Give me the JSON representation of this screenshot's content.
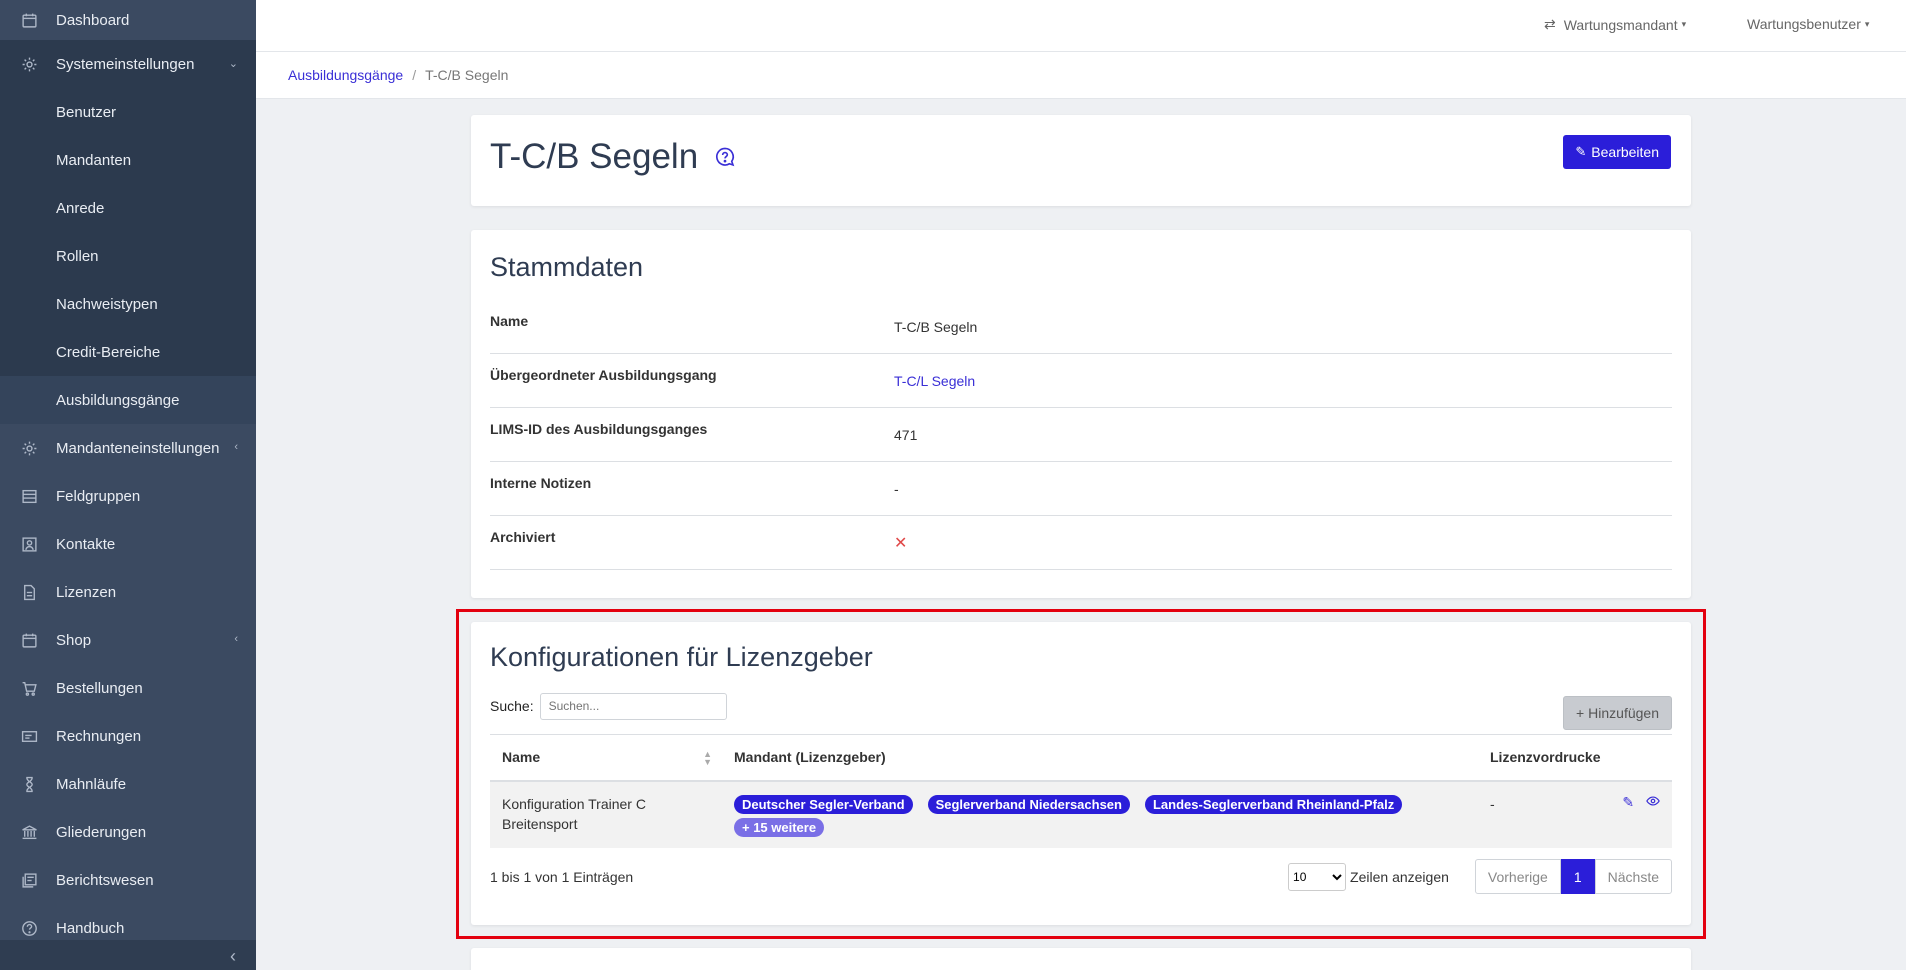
{
  "sidebar": {
    "items": [
      {
        "label": "Dashboard",
        "icon": "calendar-icon"
      },
      {
        "label": "Systemeinstellungen",
        "icon": "gear-icon",
        "chevron": "⌄"
      },
      {
        "label": "Mandanteneinstellungen",
        "icon": "gear-icon",
        "chevron": "‹"
      },
      {
        "label": "Feldgruppen",
        "icon": "list-icon"
      },
      {
        "label": "Kontakte",
        "icon": "contact-icon"
      },
      {
        "label": "Lizenzen",
        "icon": "document-icon"
      },
      {
        "label": "Shop",
        "icon": "calendar-icon",
        "chevron": "‹"
      },
      {
        "label": "Bestellungen",
        "icon": "cart-icon"
      },
      {
        "label": "Rechnungen",
        "icon": "invoice-icon"
      },
      {
        "label": "Mahnläufe",
        "icon": "hourglass-icon"
      },
      {
        "label": "Gliederungen",
        "icon": "bank-icon"
      },
      {
        "label": "Berichtswesen",
        "icon": "report-icon"
      },
      {
        "label": "Handbuch",
        "icon": "help-icon"
      }
    ],
    "sub_items": [
      "Benutzer",
      "Mandanten",
      "Anrede",
      "Rollen",
      "Nachweistypen",
      "Credit-Bereiche",
      "Ausbildungsgänge"
    ],
    "collapse_glyph": "‹"
  },
  "topbar": {
    "mandant_label": "Wartungsmandant",
    "user_label": "Wartungsbenutzer",
    "caret": "▾"
  },
  "breadcrumb": {
    "parent": "Ausbildungsgänge",
    "separator": "/",
    "current": "T-C/B Segeln"
  },
  "page": {
    "title": "T-C/B Segeln",
    "edit_button": "Bearbeiten"
  },
  "stammdaten": {
    "heading": "Stammdaten",
    "rows": [
      {
        "label": "Name",
        "value": "T-C/B Segeln"
      },
      {
        "label": "Übergeordneter Ausbildungsgang",
        "value": "T-C/L Segeln"
      },
      {
        "label": "LIMS-ID des Ausbildungsganges",
        "value": "471"
      },
      {
        "label": "Interne Notizen",
        "value": "-"
      },
      {
        "label": "Archiviert",
        "value": "✕"
      }
    ]
  },
  "konfigurationen": {
    "heading": "Konfigurationen für Lizenzgeber",
    "search_label": "Suche:",
    "search_placeholder": "Suchen...",
    "add_button": "Hinzufügen",
    "columns": [
      "Name",
      "Mandant (Lizenzgeber)",
      "Lizenzvordrucke"
    ],
    "rows": [
      {
        "name": "Konfiguration Trainer C Breitensport",
        "mandanten": [
          "Deutscher Segler-Verband",
          "Seglerverband Niedersachsen",
          "Landes-Seglerverband Rheinland-Pfalz"
        ],
        "more": "+ 15 weitere",
        "lizenzvordrucke": "-"
      }
    ],
    "info": "1 bis 1 von 1 Einträgen",
    "page_size": "10",
    "page_size_label": "Zeilen anzeigen",
    "prev": "Vorherige",
    "current_page": "1",
    "next": "Nächste"
  }
}
